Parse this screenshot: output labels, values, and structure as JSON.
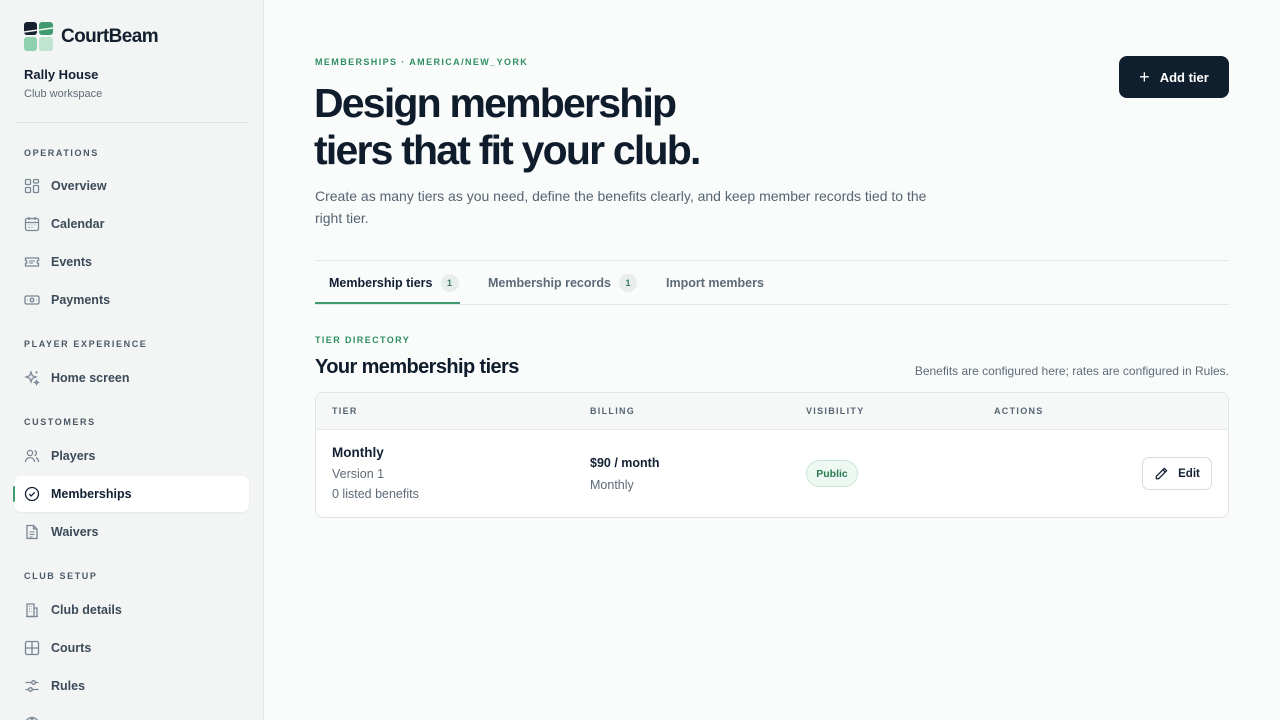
{
  "brand": {
    "name": "CourtBeam"
  },
  "workspace": {
    "name": "Rally House",
    "subtitle": "Club workspace"
  },
  "sidebar": {
    "sections": [
      {
        "label": "OPERATIONS"
      },
      {
        "label": "PLAYER EXPERIENCE"
      },
      {
        "label": "CUSTOMERS"
      },
      {
        "label": "CLUB SETUP"
      }
    ],
    "items": [
      {
        "label": "Overview",
        "icon": "grid-icon"
      },
      {
        "label": "Calendar",
        "icon": "calendar-icon"
      },
      {
        "label": "Events",
        "icon": "ticket-icon"
      },
      {
        "label": "Payments",
        "icon": "banknote-icon"
      },
      {
        "label": "Home screen",
        "icon": "sparkles-icon"
      },
      {
        "label": "Players",
        "icon": "users-icon"
      },
      {
        "label": "Memberships",
        "icon": "badge-check-icon",
        "active": true
      },
      {
        "label": "Waivers",
        "icon": "file-text-icon"
      },
      {
        "label": "Club details",
        "icon": "building-icon"
      },
      {
        "label": "Courts",
        "icon": "court-grid-icon"
      },
      {
        "label": "Rules",
        "icon": "sliders-icon"
      }
    ]
  },
  "header": {
    "eyebrow": "MEMBERSHIPS · AMERICA/NEW_YORK",
    "title_line1": "Design membership",
    "title_line2": "tiers that fit your club.",
    "intro": "Create as many tiers as you need, define the benefits clearly, and keep member records tied to the right tier.",
    "add_button": "Add tier"
  },
  "tabs": [
    {
      "label": "Membership tiers",
      "count": "1",
      "active": true
    },
    {
      "label": "Membership records",
      "count": "1"
    },
    {
      "label": "Import members"
    }
  ],
  "directory": {
    "eyebrow": "TIER DIRECTORY",
    "title": "Your membership tiers",
    "note": "Benefits are configured here; rates are configured in Rules.",
    "columns": [
      "TIER",
      "BILLING",
      "VISIBILITY",
      "ACTIONS"
    ],
    "rows": [
      {
        "name": "Monthly",
        "version": "Version 1",
        "benefits": "0 listed benefits",
        "price": "$90 / month",
        "period": "Monthly",
        "visibility": "Public",
        "action": "Edit"
      }
    ]
  },
  "colors": {
    "accent": "#3f9a6f",
    "primary_button": "#101f2e",
    "sidebar_bg": "#f2f5f4",
    "page_bg": "#fafbfb"
  }
}
